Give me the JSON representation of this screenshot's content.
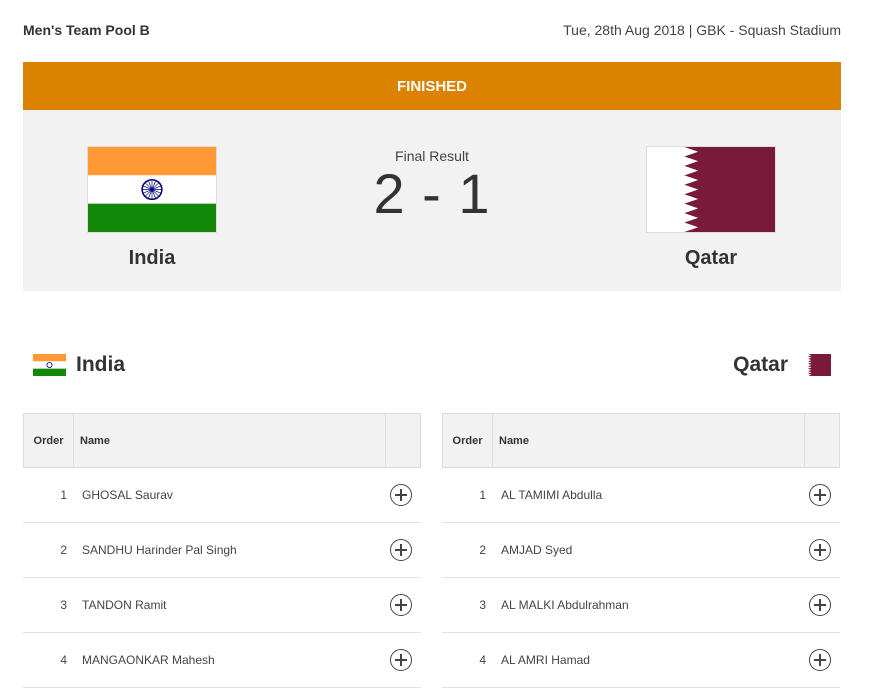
{
  "event": {
    "title": "Men's Team Pool B",
    "meta": "Tue, 28th Aug 2018 | GBK - Squash Stadium"
  },
  "status": "FINISHED",
  "colors": {
    "status_bar": "#db8200",
    "panel_bg": "#f2f2f2",
    "india_saffron": "#ff9933",
    "india_green": "#138808",
    "india_chakra": "#000080",
    "qatar_maroon": "#8a1538"
  },
  "result": {
    "label": "Final Result",
    "score": "2 - 1"
  },
  "home": {
    "name": "India",
    "flag_icon": "india-flag-icon",
    "header_name": "India",
    "columns": {
      "order": "Order",
      "name": "Name"
    },
    "players": [
      {
        "order": "1",
        "name": "GHOSAL Saurav"
      },
      {
        "order": "2",
        "name": "SANDHU Harinder Pal Singh"
      },
      {
        "order": "3",
        "name": "TANDON Ramit"
      },
      {
        "order": "4",
        "name": "MANGAONKAR Mahesh"
      }
    ]
  },
  "away": {
    "name": "Qatar",
    "flag_icon": "qatar-flag-icon",
    "header_name": "Qatar",
    "columns": {
      "order": "Order",
      "name": "Name"
    },
    "players": [
      {
        "order": "1",
        "name": "AL TAMIMI Abdulla"
      },
      {
        "order": "2",
        "name": "AMJAD Syed"
      },
      {
        "order": "3",
        "name": "AL MALKI Abdulrahman"
      },
      {
        "order": "4",
        "name": "AL AMRI Hamad"
      }
    ]
  }
}
